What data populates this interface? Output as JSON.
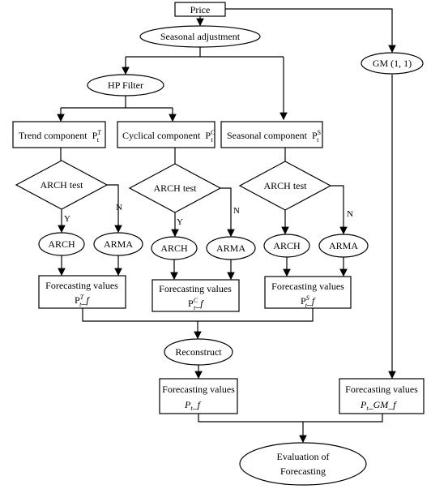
{
  "price": "Price",
  "seasonal_adjustment": "Seasonal adjustment",
  "gm": "GM (1, 1)",
  "hp_filter": "HP Filter",
  "components": [
    {
      "label": "Trend component",
      "symbol": "P",
      "sup": "T",
      "sub": "t"
    },
    {
      "label": "Cyclical component",
      "symbol": "P",
      "sup": "C",
      "sub": "t"
    },
    {
      "label": "Seasonal component",
      "symbol": "P",
      "sup": "S",
      "sub": "t"
    }
  ],
  "arch_test": "ARCH test",
  "yes": "Y",
  "no": "N",
  "arch": "ARCH",
  "arma": "ARMA",
  "forecasting_values": "Forecasting values",
  "forecast_suffix": "_f",
  "reconstruct": "Reconstruct",
  "final_forecast": {
    "symbol": "P",
    "sub": "t",
    "suffix": "_f"
  },
  "gm_forecast": {
    "symbol": "P",
    "sub": "t",
    "suffix": "_GM_f"
  },
  "evaluation": [
    "Evaluation of",
    "Forecasting"
  ]
}
